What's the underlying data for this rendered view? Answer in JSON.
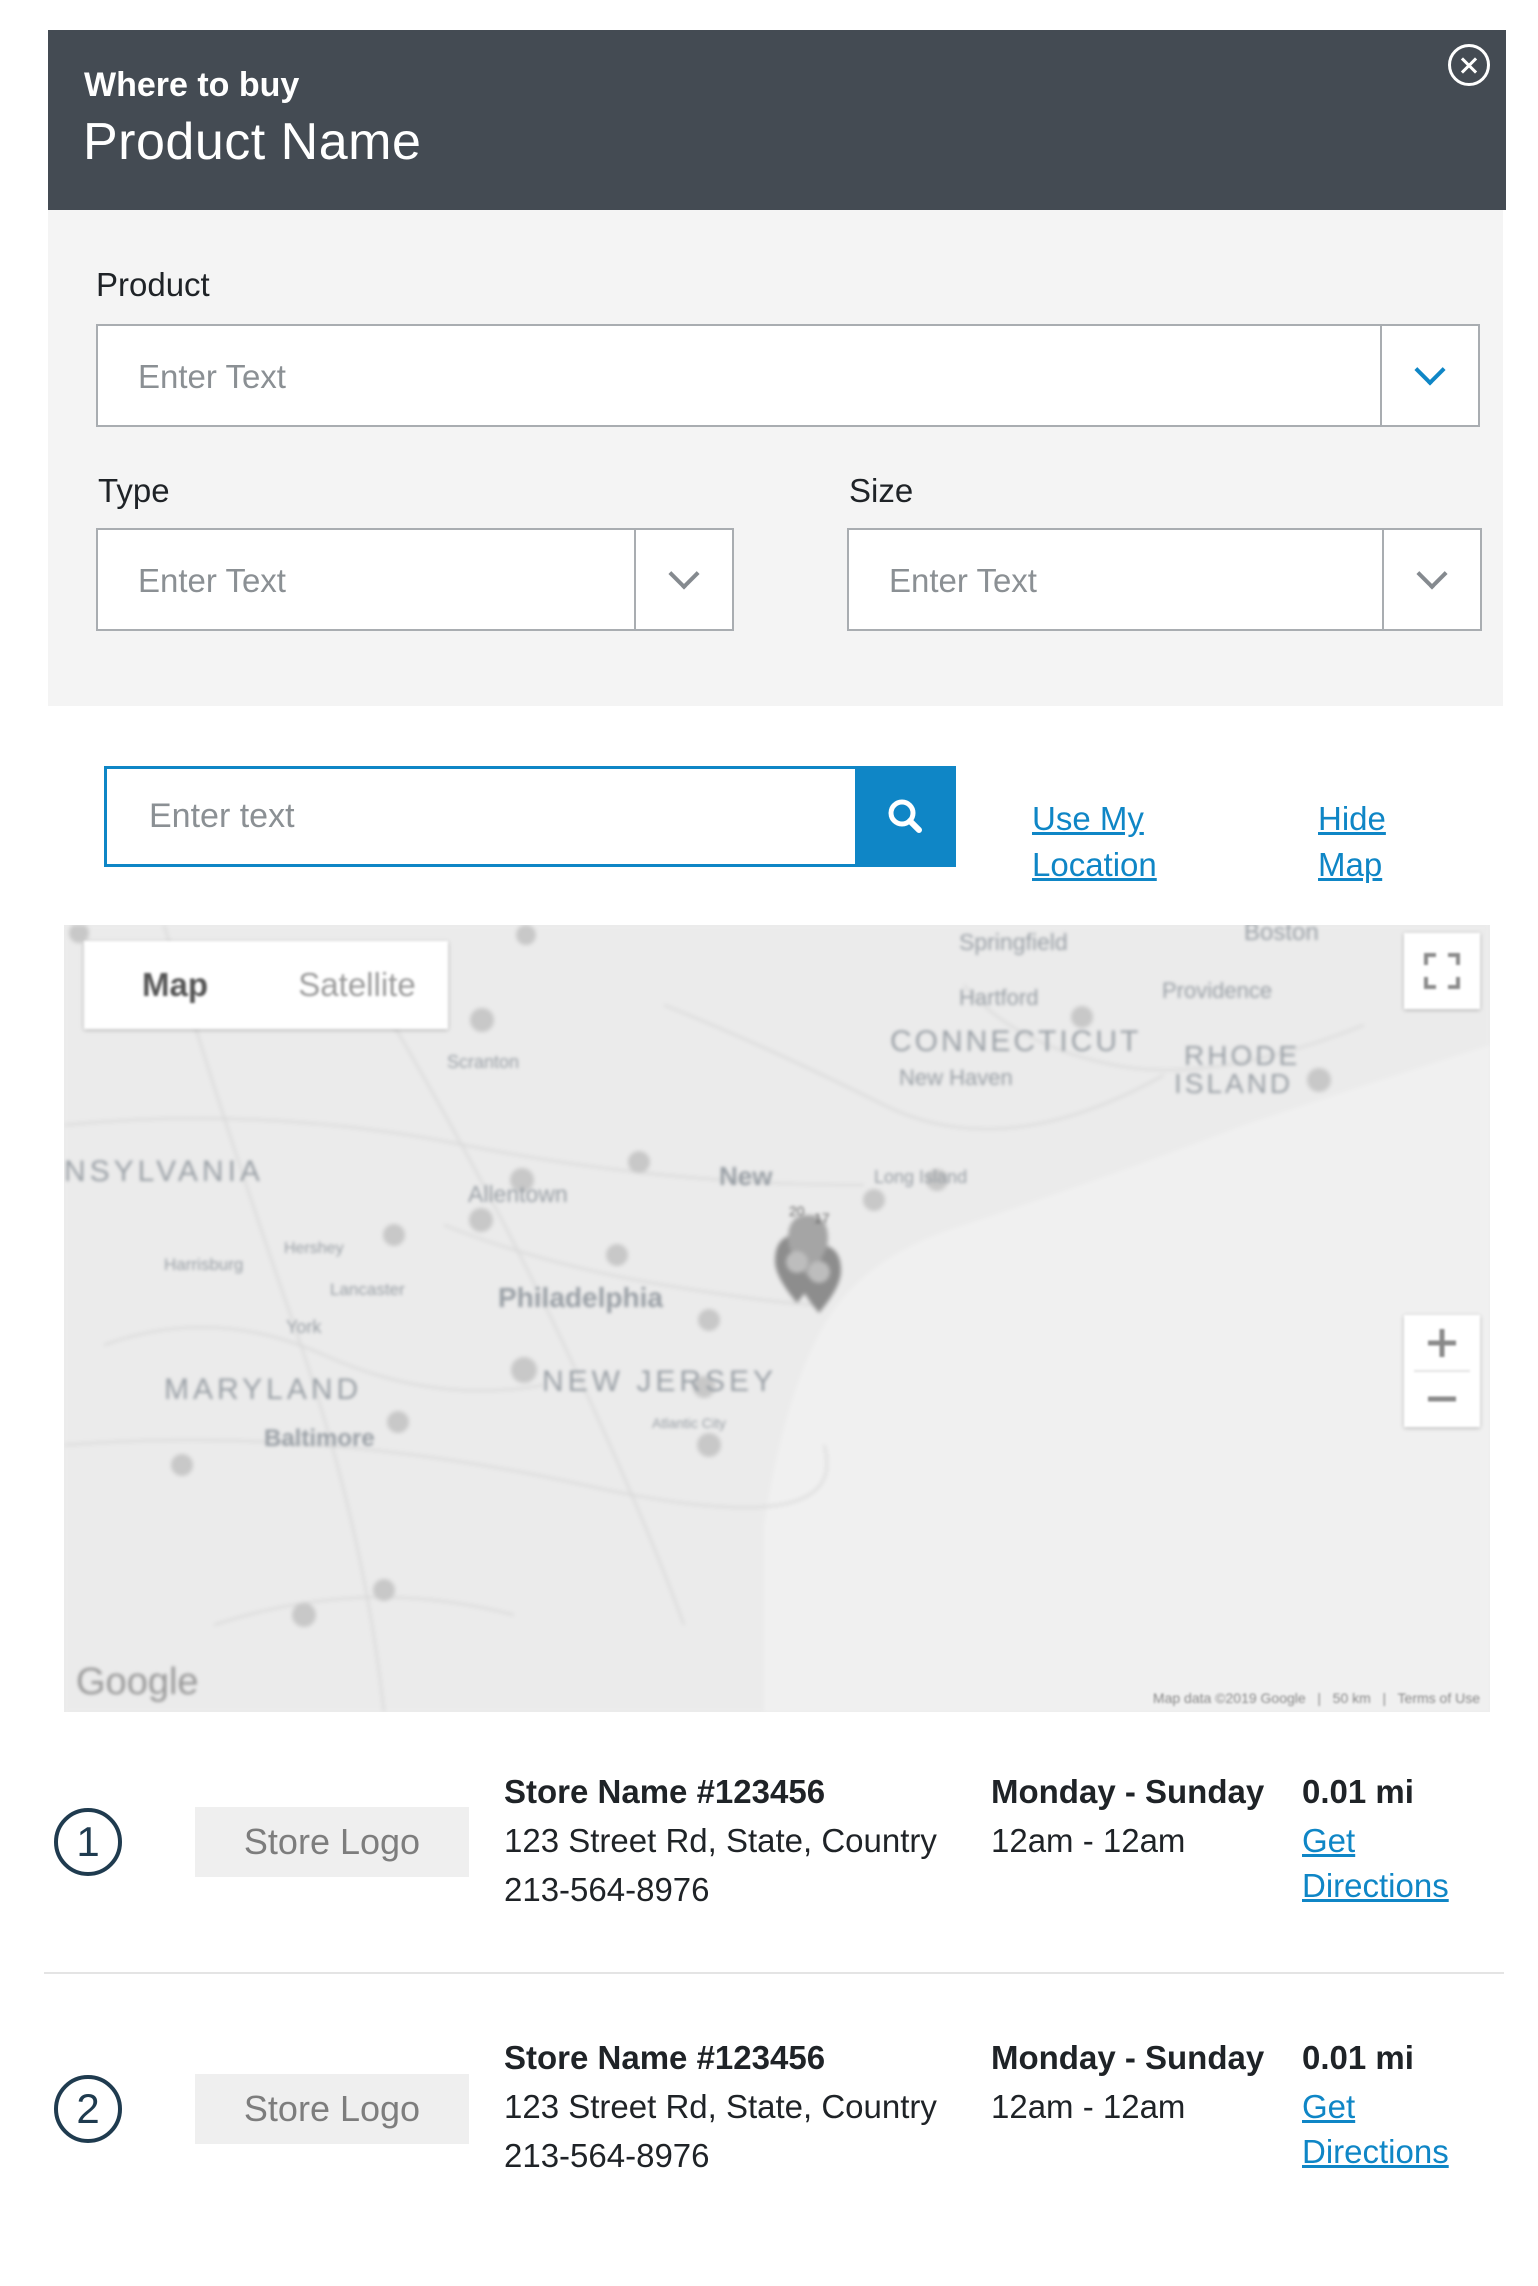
{
  "header": {
    "eyebrow": "Where to buy",
    "title": "Product Name",
    "close_icon": "close-circle-icon"
  },
  "filters": {
    "product": {
      "label": "Product",
      "placeholder": "Enter Text"
    },
    "type": {
      "label": "Type",
      "placeholder": "Enter Text"
    },
    "size": {
      "label": "Size",
      "placeholder": "Enter Text"
    },
    "dropdown_icon": "chevron-down-icon"
  },
  "search": {
    "placeholder": "Enter text",
    "button_icon": "search-icon",
    "use_location": [
      "Use My",
      "Location"
    ],
    "hide_map": [
      "Hide",
      "Map"
    ]
  },
  "map": {
    "type_buttons": [
      "Map",
      "Satellite"
    ],
    "labels": {
      "springfield": "Springfield",
      "boston": "Boston",
      "hartford": "Hartford",
      "providence": "Providence",
      "connecticut": "CONNECTICUT",
      "rhode": "RHODE",
      "island": "ISLAND",
      "new_haven": "New Haven",
      "scranton": "Scranton",
      "pennsylvania": "NSYLVANIA",
      "new_york": "New",
      "long_island": "Long Island",
      "allentown": "Allentown",
      "hershey": "Hershey",
      "harrisburg": "Harrisburg",
      "lancaster": "Lancaster",
      "philadelphia": "Philadelphia",
      "york": "York",
      "maryland": "MARYLAND",
      "new_jersey": "NEW JERSEY",
      "baltimore": "Baltimore",
      "atlantic_city": "Atlantic City"
    },
    "marker_labels": [
      "20",
      "17"
    ],
    "google": "Google",
    "footer": [
      "Map data ©2019 Google",
      "50 km",
      "Terms of Use"
    ],
    "icons": [
      "fullscreen-icon",
      "zoom-in-icon",
      "zoom-out-icon",
      "map-pin-icon"
    ]
  },
  "results": [
    {
      "number": "1",
      "logo": "Store Logo",
      "name": "Store Name #123456",
      "address": "123 Street Rd, State, Country",
      "phone": "213-564-8976",
      "days": "Monday - Sunday",
      "hours": "12am - 12am",
      "distance": "0.01 mi",
      "directions": [
        "Get",
        "Directions"
      ]
    },
    {
      "number": "2",
      "logo": "Store Logo",
      "name": "Store Name #123456",
      "address": "123 Street Rd, State, Country",
      "phone": "213-564-8976",
      "days": "Monday - Sunday",
      "hours": "12am - 12am",
      "distance": "0.01 mi",
      "directions": [
        "Get",
        "Directions"
      ]
    }
  ],
  "colors": {
    "header_bg": "#444b53",
    "panel_bg": "#f4f4f4",
    "accent": "#0f86c6",
    "number_circle": "#1f3b4f"
  }
}
